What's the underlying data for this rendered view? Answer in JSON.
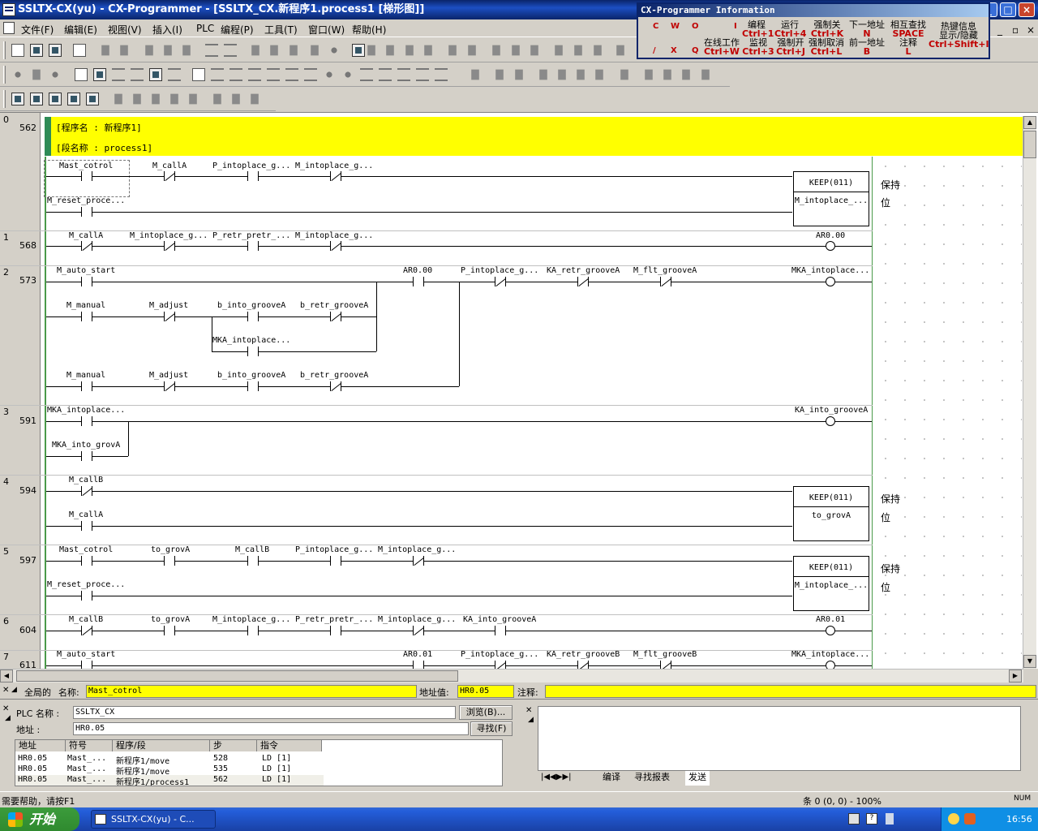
{
  "window": {
    "title": "SSLTX-CX(yu) - CX-Programmer - [SSLTX_CX.新程序1.process1 [梯形图]]",
    "minimize": "_",
    "maximize": "□",
    "close": "×"
  },
  "menu": [
    "文件(F)",
    "编辑(E)",
    "视图(V)",
    "插入(I)",
    "PLC",
    "编程(P)",
    "工具(T)",
    "窗口(W)",
    "帮助(H)"
  ],
  "mdi_controls": [
    "_",
    "▫",
    "×"
  ],
  "info_panel": {
    "title": "CX-Programmer Information",
    "row1_syms": [
      "C",
      "W",
      "O",
      "I"
    ],
    "row1": [
      {
        "t": "编程",
        "k": "Ctrl+1"
      },
      {
        "t": "运行",
        "k": "Ctrl+4"
      },
      {
        "t": "强制关",
        "k": "Ctrl+K"
      },
      {
        "t": "下一地址",
        "k": "N"
      },
      {
        "t": "相互查找",
        "k": "SPACE"
      }
    ],
    "row2_syms": [
      "/",
      "X",
      "Q"
    ],
    "row2": [
      {
        "t": "在线工作",
        "k": "Ctrl+W"
      },
      {
        "t": "监视",
        "k": "Ctrl+3"
      },
      {
        "t": "强制开",
        "k": "Ctrl+J"
      },
      {
        "t": "强制取消",
        "k": "Ctrl+L"
      },
      {
        "t": "前一地址",
        "k": "B"
      },
      {
        "t": "注释",
        "k": "L"
      }
    ],
    "hotkey": {
      "t1": "热键信息",
      "t2": "显示/隐藏",
      "k": "Ctrl+Shift+I"
    }
  },
  "header": {
    "program": "[程序名 : 新程序1]",
    "section": "[段名称 : process1]"
  },
  "rungs": [
    {
      "num": "0",
      "step": "562"
    },
    {
      "num": "1",
      "step": "568"
    },
    {
      "num": "2",
      "step": "573"
    },
    {
      "num": "3",
      "step": "591"
    },
    {
      "num": "4",
      "step": "594"
    },
    {
      "num": "5",
      "step": "597"
    },
    {
      "num": "6",
      "step": "604"
    },
    {
      "num": "7",
      "step": "611"
    }
  ],
  "ladder": {
    "r0": {
      "c1": "Mast_cotrol",
      "c2": "M_callA",
      "c3": "P_intoplace_g...",
      "c4": "M_intoplace_g...",
      "c5": "M_reset_proce...",
      "fb1": "KEEP(011)",
      "fb2": "M_intoplace_...",
      "cm1": "保持",
      "cm2": "位"
    },
    "r1": {
      "c1": "M_callA",
      "c2": "M_intoplace_g...",
      "c3": "P_retr_pretr_...",
      "c4": "M_intoplace_g...",
      "coil": "AR0.00"
    },
    "r2": {
      "c1": "M_auto_start",
      "c2": "AR0.00",
      "c3": "P_intoplace_g...",
      "c4": "KA_retr_grooveA",
      "c5": "M_flt_grooveA",
      "coil": "MKA_intoplace...",
      "c6": "M_manual",
      "c7": "M_adjust",
      "c8": "b_into_grooveA",
      "c9": "b_retr_grooveA",
      "c10": "MKA_intoplace...",
      "c11": "M_manual",
      "c12": "M_adjust",
      "c13": "b_into_grooveA",
      "c14": "b_retr_grooveA"
    },
    "r3": {
      "c1": "MKA_intoplace...",
      "c2": "MKA_into_grovA",
      "coil": "KA_into_grooveA"
    },
    "r4": {
      "c1": "M_callB",
      "c2": "M_callA",
      "fb1": "KEEP(011)",
      "fb2": "to_grovA",
      "cm1": "保持",
      "cm2": "位"
    },
    "r5": {
      "c1": "Mast_cotrol",
      "c2": "to_grovA",
      "c3": "M_callB",
      "c4": "P_intoplace_g...",
      "c5": "M_intoplace_g...",
      "c6": "M_reset_proce...",
      "fb1": "KEEP(011)",
      "fb2": "M_intoplace_...",
      "cm1": "保持",
      "cm2": "位"
    },
    "r6": {
      "c1": "M_callB",
      "c2": "to_grovA",
      "c3": "M_intoplace_g...",
      "c4": "P_retr_pretr_...",
      "c5": "M_intoplace_g...",
      "c6": "KA_into_grooveA",
      "coil": "AR0.01"
    },
    "r7": {
      "c1": "M_auto_start",
      "c2": "AR0.01",
      "c3": "P_intoplace_g...",
      "c4": "KA_retr_grooveB",
      "c5": "M_flt_grooveB",
      "coil": "MKA_intoplace..."
    }
  },
  "global_bar": {
    "scope": "全局的",
    "name_label": "名称:",
    "name_value": "Mast_cotrol",
    "addr_label": "地址值:",
    "addr_value": "HR0.05",
    "comment_label": "注释:",
    "comment_value": ""
  },
  "find": {
    "plc_label": "PLC 名称 :",
    "plc_value": "SSLTX_CX",
    "addr_label": "地址 :",
    "addr_value": "HR0.05",
    "browse": "浏览(B)...",
    "search": "寻找(F)",
    "columns": [
      "地址",
      "符号",
      "程序/段",
      "步",
      "指令"
    ],
    "rows": [
      [
        "HR0.05",
        "Mast_...",
        "新程序1/move",
        "528",
        "LD [1]"
      ],
      [
        "HR0.05",
        "Mast_...",
        "新程序1/move",
        "535",
        "LD [1]"
      ],
      [
        "HR0.05",
        "Mast_...",
        "新程序1/process1",
        "562",
        "LD [1]"
      ]
    ]
  },
  "output_tabs": [
    "编译",
    "寻找报表",
    "发送"
  ],
  "status": {
    "help": "需要帮助，请按F1",
    "pos": "条 0 (0, 0) - 100%",
    "mode": "NUM"
  },
  "taskbar": {
    "start": "开始",
    "app": "SSLTX-CX(yu) - C...",
    "time": "16:56"
  }
}
